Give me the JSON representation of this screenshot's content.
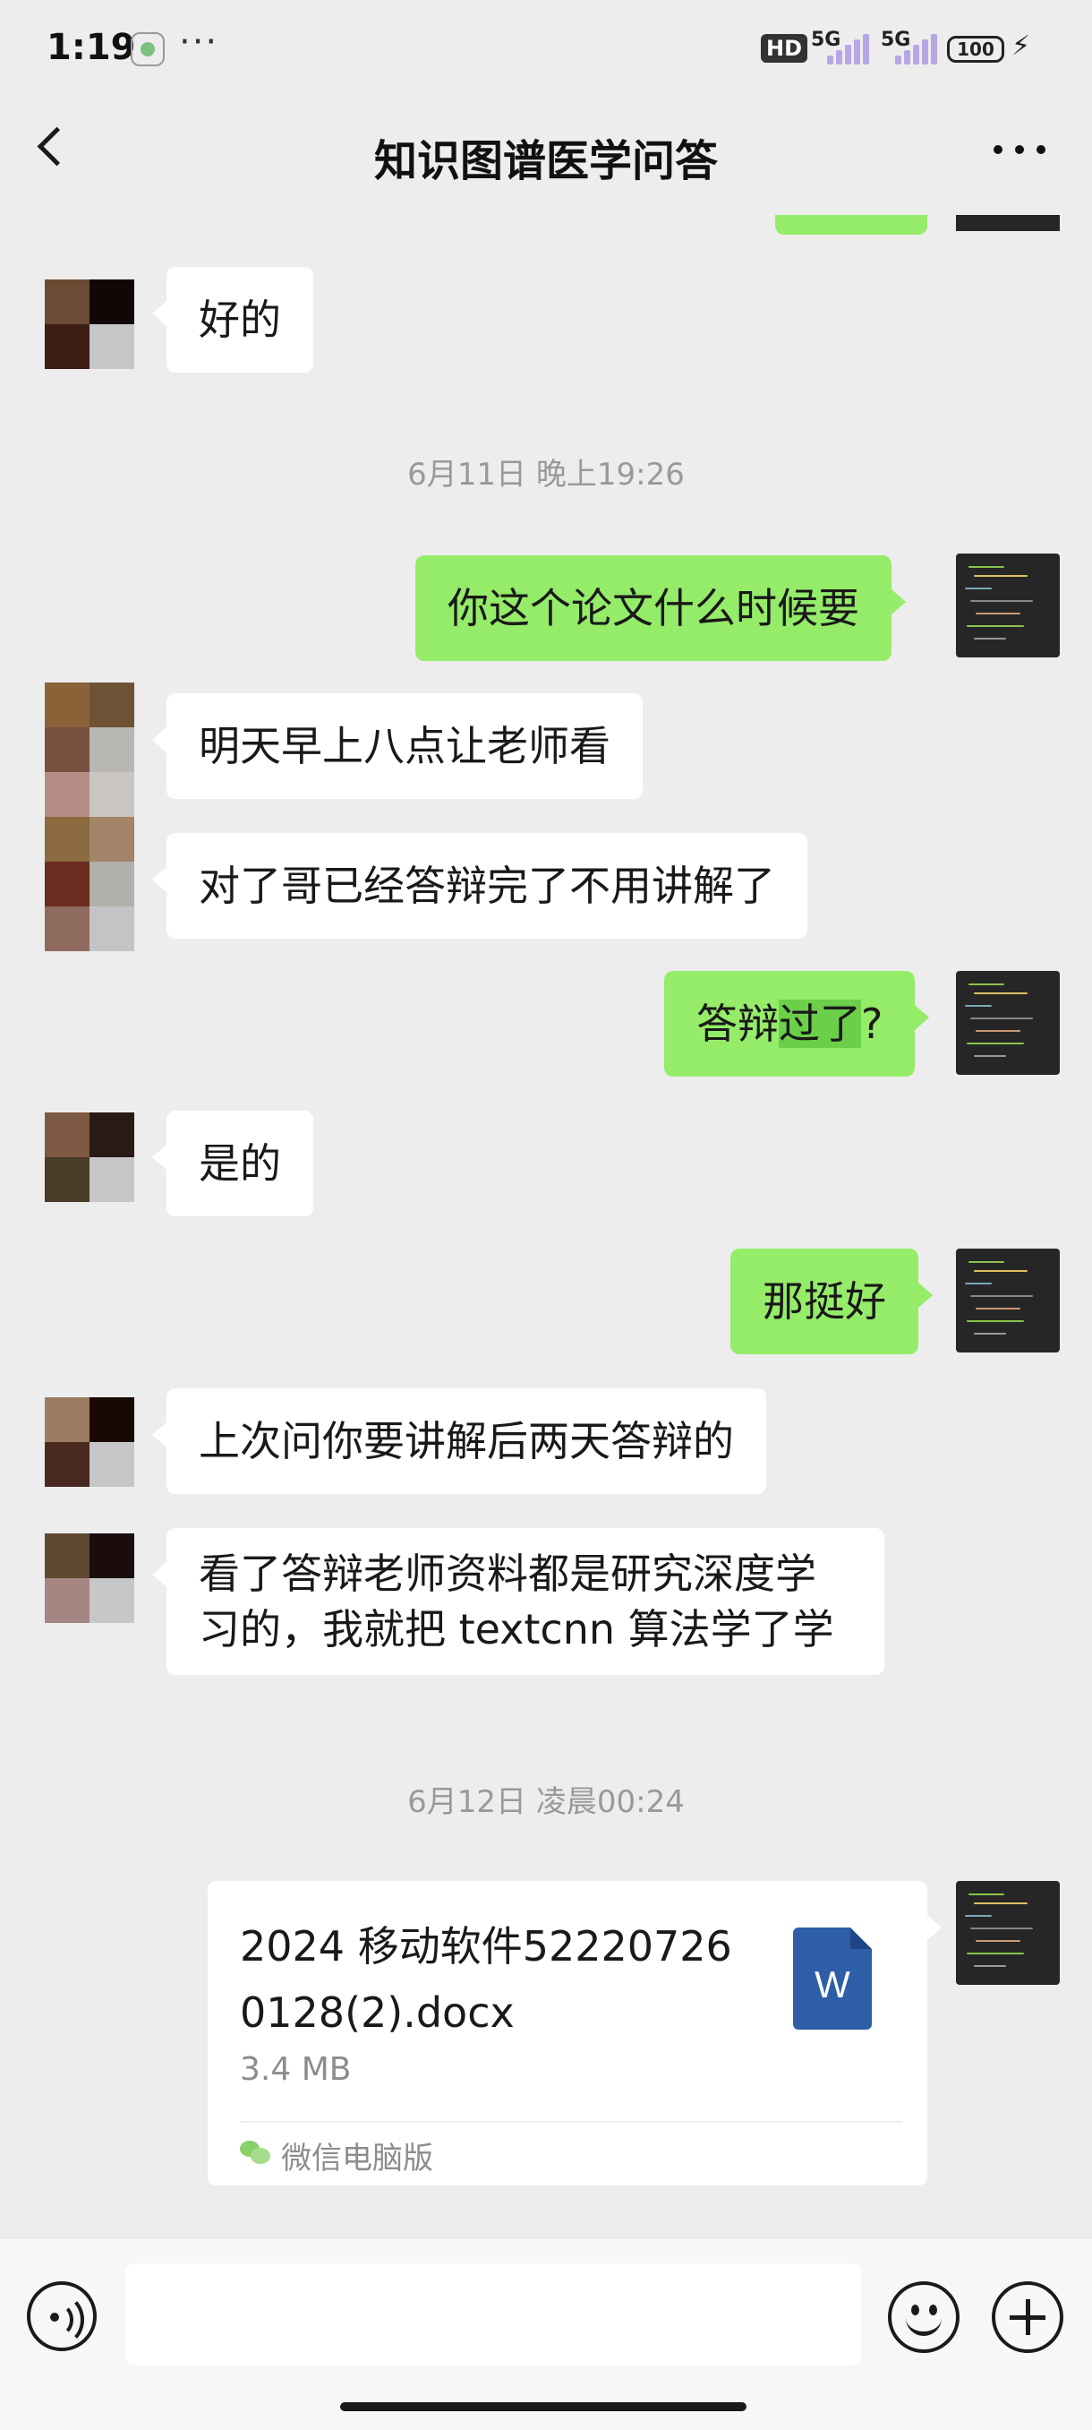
{
  "status_bar": {
    "time": "1:19",
    "more": "···",
    "hd_badge": "HD",
    "network_1": "5G",
    "network_2": "5G",
    "battery": "100",
    "icons": [
      "app-notification-icon",
      "signal-icon",
      "battery-icon",
      "charging-icon"
    ]
  },
  "header": {
    "title": "知识图谱医学问答",
    "back_icon": "chevron-left-icon",
    "more_icon": "more-dots-icon"
  },
  "messages": [
    {
      "side": "left",
      "text": "好的"
    },
    {
      "side": "timestamp",
      "text": "6月11日 晚上19:26"
    },
    {
      "side": "right",
      "text": "你这个论文什么时候要"
    },
    {
      "side": "left",
      "text": "明天早上八点让老师看"
    },
    {
      "side": "left",
      "text": "对了哥已经答辩完了不用讲解了"
    },
    {
      "side": "right",
      "text_parts": [
        "答辩",
        "过了",
        "?"
      ]
    },
    {
      "side": "left",
      "text": "是的"
    },
    {
      "side": "right",
      "text": "那挺好"
    },
    {
      "side": "left",
      "text": "上次问你要讲解后两天答辩的"
    },
    {
      "side": "left",
      "lines": [
        "看了答辩老师资料都是研究深度学",
        "习的，我就把 textcnn 算法学了学"
      ]
    },
    {
      "side": "timestamp",
      "text": "6月12日 凌晨00:24"
    }
  ],
  "file_message": {
    "name": "2024 移动软件522207260128(2).docx",
    "size": "3.4 MB",
    "source": "微信电脑版",
    "file_icon": "word-document-icon",
    "file_icon_label": "W",
    "source_icon": "wechat-icon"
  },
  "input_bar": {
    "placeholder": "",
    "voice_icon": "voice-icon",
    "emoji_icon": "emoji-icon",
    "plus_icon": "plus-icon"
  },
  "colors": {
    "background": "#ededed",
    "bubble_self": "#95ec69",
    "bubble_other": "#ffffff",
    "timestamp": "#999999",
    "word_blue": "#2f5ea8"
  }
}
